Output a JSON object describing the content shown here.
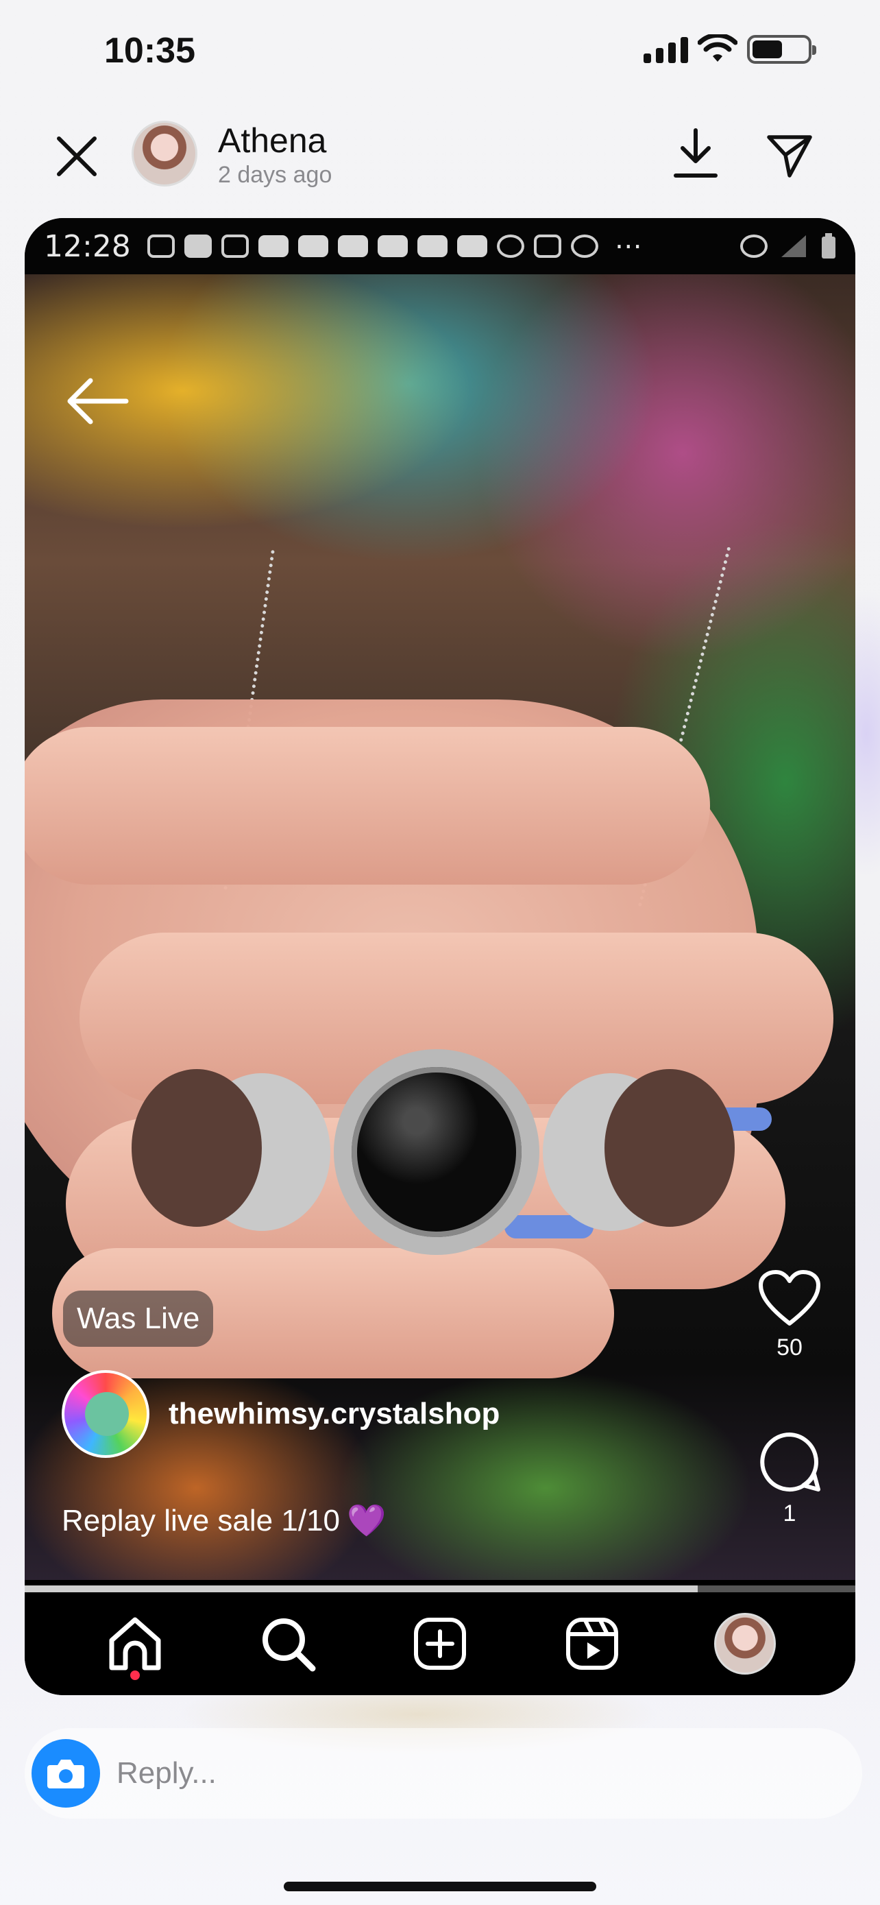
{
  "status_bar": {
    "time": "10:35",
    "battery_level": 0.55
  },
  "story_header": {
    "user_name": "Athena",
    "posted_time": "2 days ago",
    "icons": {
      "close": "close-icon",
      "download": "download-icon",
      "share": "send-icon"
    }
  },
  "inner_status_bar": {
    "time": "12:28"
  },
  "reel": {
    "badge": "Was Live",
    "username": "thewhimsy.crystalshop",
    "caption": "Replay live sale 1/10",
    "caption_emoji": "💜",
    "likes": "50",
    "comments": "1",
    "progress": 0.81,
    "icons": {
      "back": "back-arrow-icon",
      "like": "heart-icon",
      "comment": "comment-icon",
      "share": "send-icon",
      "more": "more-vertical-icon"
    }
  },
  "tab_bar": {
    "items": [
      "home-icon",
      "search-icon",
      "create-icon",
      "reels-icon",
      "profile-avatar"
    ],
    "active": "home-icon"
  },
  "reply": {
    "placeholder": "Reply...",
    "camera_icon": "camera-icon"
  },
  "colors": {
    "accent": "#1a8cff",
    "notification_dot": "#ff2e4d",
    "caption_heart": "#b44cff"
  }
}
